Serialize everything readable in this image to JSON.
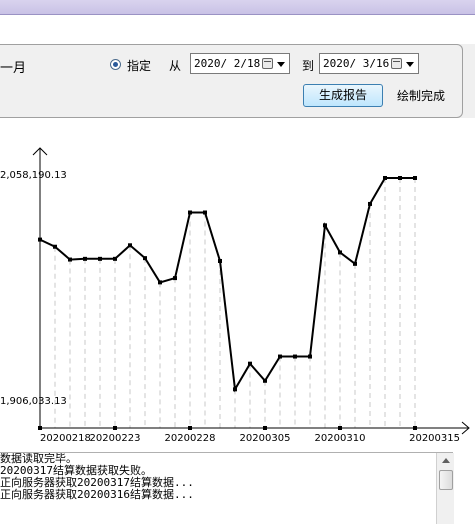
{
  "toolbar": {
    "month_label": "一月",
    "radio_label": "指定",
    "from_label": "从",
    "to_label": "到",
    "start_date": "2020/ 2/18",
    "end_date": "2020/ 3/16",
    "generate_button": "生成报告",
    "status": "绘制完成"
  },
  "chart_data": {
    "type": "line",
    "y_tick_labels": [
      "2,058,190.13",
      "1,906,033.13"
    ],
    "ylim": [
      1906033.13,
      2058190.13
    ],
    "x_tick_labels": [
      "20200218",
      "20200223",
      "20200228",
      "20200305",
      "20200310",
      "20200315"
    ],
    "x": [
      "20200218",
      "20200219",
      "20200220",
      "20200221",
      "20200222",
      "20200223",
      "20200224",
      "20200225",
      "20200226",
      "20200227",
      "20200228",
      "20200229",
      "20200301",
      "20200302",
      "20200303",
      "20200304",
      "20200305",
      "20200306",
      "20200307",
      "20200308",
      "20200309",
      "20200310",
      "20200311",
      "20200312",
      "20200313",
      "20200314",
      "20200315"
    ],
    "values": [
      2015000,
      2010000,
      2001000,
      2001500,
      2001500,
      2001500,
      2011000,
      2002000,
      1985000,
      1988000,
      2034000,
      2034000,
      2000000,
      1910000,
      1928000,
      1916000,
      1933000,
      1933000,
      1933000,
      2025000,
      2006000,
      1998000,
      2040000,
      2058190,
      2058190,
      2058190
    ],
    "grid": "vertical-dashed-drop-lines",
    "legend": "none"
  },
  "log": {
    "lines": [
      "数据读取完毕。",
      "20200317结算数据获取失败。",
      "正向服务器获取20200317结算数据...",
      "正向服务器获取20200316结算数据..."
    ]
  }
}
